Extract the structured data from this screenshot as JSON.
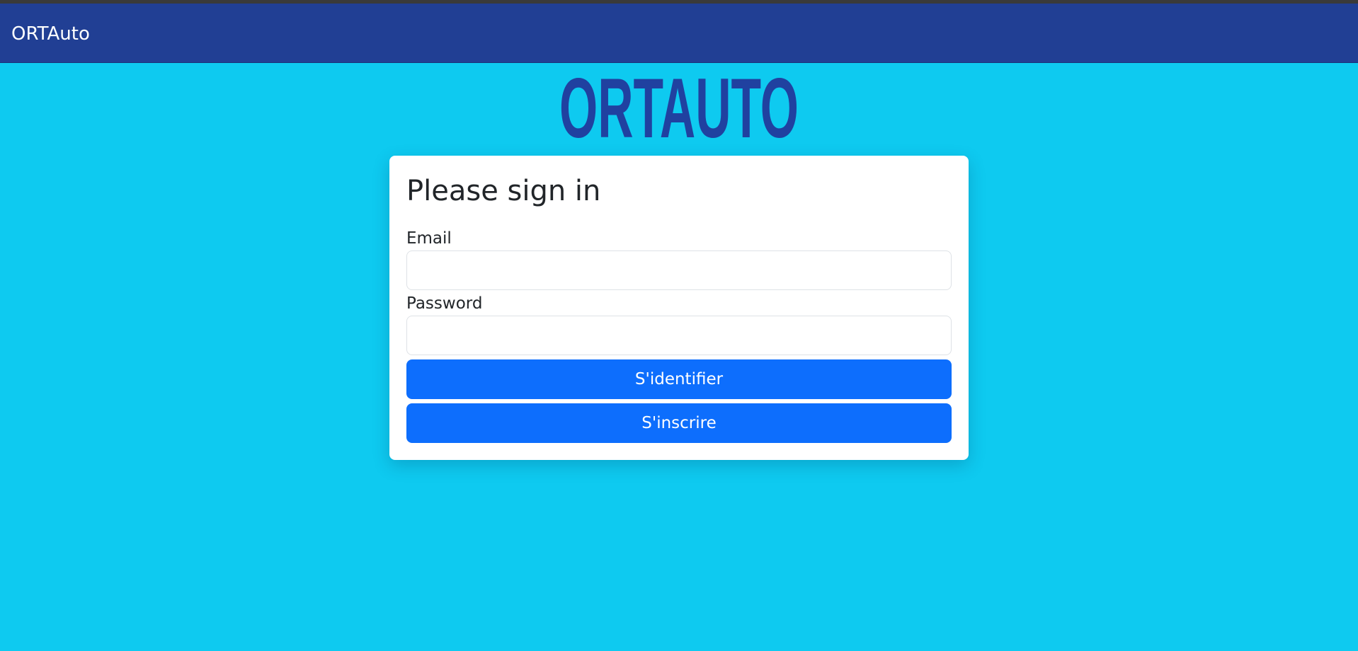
{
  "navbar": {
    "brand": "ORTAuto"
  },
  "logo": {
    "text": "ORTAUTO",
    "color": "#2041a0"
  },
  "colors": {
    "background": "#0ecaf0",
    "navbar": "#213f94",
    "primary_button": "#0d6efd"
  },
  "login": {
    "title": "Please sign in",
    "email_label": "Email",
    "email_value": "",
    "password_label": "Password",
    "password_value": "",
    "login_button": "S'identifier",
    "register_button": "S'inscrire"
  }
}
